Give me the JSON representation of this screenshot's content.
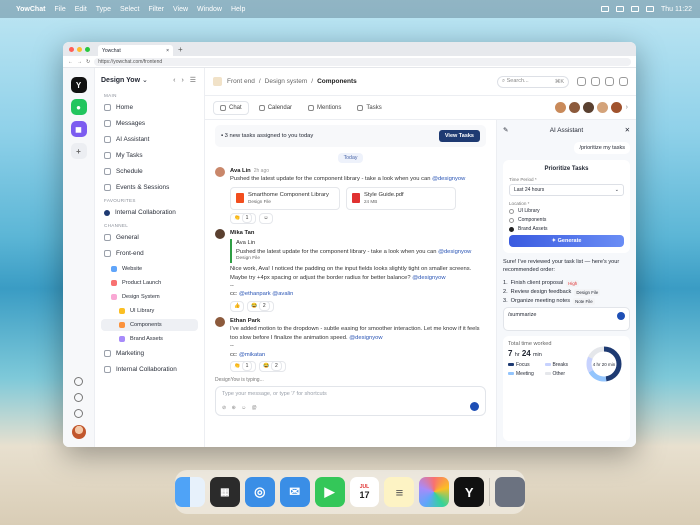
{
  "menubar": {
    "app": "YowChat",
    "items": [
      "File",
      "Edit",
      "Type",
      "Select",
      "Filter",
      "View",
      "Window",
      "Help"
    ],
    "clock": "Thu 11:22"
  },
  "browser": {
    "tab_title": "Yowchat",
    "url": "https://yowchat.com/frontend"
  },
  "sidebar": {
    "workspace": "Design Yow",
    "main_label": "MAIN",
    "main_items": [
      "Home",
      "Messages",
      "AI Assistant",
      "My Tasks",
      "Schedule",
      "Events & Sessions"
    ],
    "favourites_label": "FAVOURITES",
    "favourites": [
      "Internal Collaboration"
    ],
    "channel_label": "CHANNEL",
    "channels": {
      "general": "General",
      "frontend": "Front-end",
      "website": "Website",
      "product_launch": "Product Launch",
      "design_system": "Design System",
      "ui_library": "UI Library",
      "components": "Components",
      "brand_assets": "Brand Assets",
      "marketing": "Marketing",
      "internal": "Internal Collaboration"
    }
  },
  "topbar": {
    "crumbs": [
      "Front end",
      "Design system",
      "Components"
    ],
    "search_placeholder": "Search...",
    "search_shortcut": "⌘K"
  },
  "tabs": [
    "Chat",
    "Calendar",
    "Mentions",
    "Tasks"
  ],
  "chat": {
    "banner": "3 new tasks assigned to you today",
    "banner_btn": "View Tasks",
    "today": "Today",
    "m1": {
      "name": "Ava Lin",
      "time": "2h ago",
      "text": "Pushed the latest update for the component library - take a look when you can ",
      "mention": "@designyow",
      "file1_name": "Smarthome Component Library",
      "file1_meta": "Design File",
      "file2_name": "Style Guide.pdf",
      "file2_meta": "24 MB",
      "react": "1"
    },
    "m2": {
      "name": "Mika Tan",
      "quote_name": "Ava Lin",
      "quote_text": "Pushed the latest update for the component library - take a look when you can ",
      "quote_mention": "@designyow",
      "quote_file": "Design File",
      "text": "Nice work, Ava! I noticed the padding on the input fields looks slightly tight on smaller screens. Maybe try +4px spacing or adjust the border radius for better balance? ",
      "mention": "@designyow",
      "dash": "--",
      "cc_label": "cc: ",
      "cc": "@ethanpark @avalin",
      "react": "2"
    },
    "m3": {
      "name": "Ethan Park",
      "text": "I've added motion to the dropdown - subtle easing for smoother interaction. Let me know if it feels too slow before I finalize the animation speed. ",
      "mention": "@designyow",
      "dash": "--",
      "cc_label": "cc: ",
      "cc": "@mikatan",
      "react1": "1",
      "react2": "2"
    },
    "typing": "DesignYow is typing...",
    "composer_placeholder": "Type your message, or type '/' for shortcuts"
  },
  "ai": {
    "title": "AI Assistant",
    "prompt": "/prioritize my tasks",
    "card_title": "Prioritize Tasks",
    "period_label": "Time Period *",
    "period_value": "Last 24 hours",
    "location_label": "Location *",
    "locations": [
      "UI Library",
      "Components",
      "Brand Assets"
    ],
    "generate": "Generate",
    "reply": "Sure! I've reviewed your task list — here's your recommended order:",
    "tasks": [
      {
        "n": "1.",
        "t": "Finish client proposal",
        "tag": "High"
      },
      {
        "n": "2.",
        "t": "Review design feedback",
        "tag": "Design File"
      },
      {
        "n": "3.",
        "t": "Organize meeting notes",
        "tag": "Note File"
      }
    ],
    "composer_text": "/summarize",
    "time_label": "Total time worked",
    "time_h": "7",
    "time_h_unit": "hr",
    "time_m": "24",
    "time_m_unit": "min",
    "legend": [
      "Focus",
      "Breaks",
      "Meeting",
      "Other"
    ],
    "donut_h": "4",
    "donut_h_unit": "hr",
    "donut_m": "20",
    "donut_m_unit": "min"
  },
  "dock": {
    "calendar_month": "JUL",
    "calendar_day": "17"
  }
}
